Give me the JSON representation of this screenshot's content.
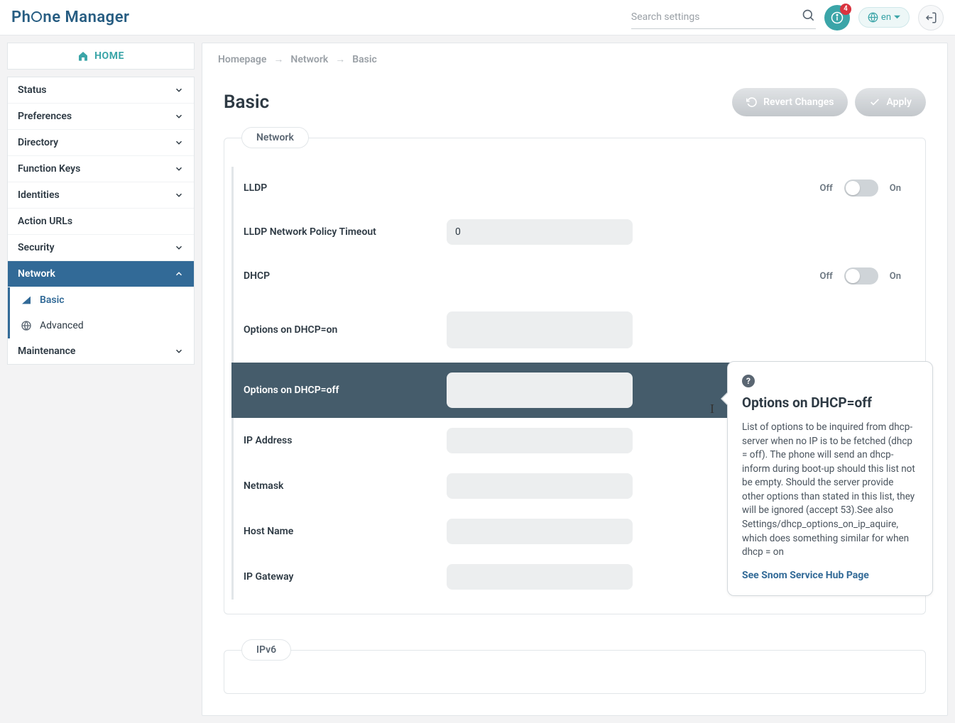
{
  "app": {
    "title": "Phone Manager",
    "search_placeholder": "Search settings",
    "notification_count": "4",
    "lang": "en"
  },
  "sidebar": {
    "home": "HOME",
    "items": [
      {
        "label": "Status",
        "children": true
      },
      {
        "label": "Preferences",
        "children": true
      },
      {
        "label": "Directory",
        "children": true
      },
      {
        "label": "Function Keys",
        "children": true
      },
      {
        "label": "Identities",
        "children": true
      },
      {
        "label": "Action URLs",
        "children": false
      },
      {
        "label": "Security",
        "children": true
      },
      {
        "label": "Network",
        "children": true,
        "active": true,
        "open": true,
        "sub": [
          {
            "label": "Basic",
            "selected": true
          },
          {
            "label": "Advanced",
            "selected": false
          }
        ]
      },
      {
        "label": "Maintenance",
        "children": true
      }
    ]
  },
  "breadcrumbs": [
    "Homepage",
    "Network",
    "Basic"
  ],
  "page": {
    "title": "Basic",
    "revert": "Revert Changes",
    "apply": "Apply"
  },
  "sections": {
    "network": {
      "legend": "Network",
      "rows": {
        "lldp": {
          "label": "LLDP",
          "off": "Off",
          "on": "On"
        },
        "lldp_timeout": {
          "label": "LLDP Network Policy Timeout",
          "value": "0"
        },
        "dhcp": {
          "label": "DHCP",
          "off": "Off",
          "on": "On"
        },
        "opt_on": {
          "label": "Options on DHCP=on",
          "value": ""
        },
        "opt_off": {
          "label": "Options on DHCP=off",
          "value": ""
        },
        "ip_addr": {
          "label": "IP Address",
          "value": ""
        },
        "netmask": {
          "label": "Netmask",
          "value": ""
        },
        "hostname": {
          "label": "Host Name",
          "value": ""
        },
        "gateway": {
          "label": "IP Gateway",
          "value": ""
        }
      }
    },
    "ipv6": {
      "legend": "IPv6"
    }
  },
  "tooltip": {
    "title": "Options on DHCP=off",
    "body": "List of options to be inquired from dhcp-server when no IP is to be fetched (dhcp = off). The phone will send an dhcp-inform during boot-up should this list not be empty. Should the server provide other options than stated in this list, they will be ignored (accept 53).See also Settings/dhcp_options_on_ip_aquire, which does something similar for when dhcp = on",
    "link": "See Snom Service Hub Page"
  }
}
